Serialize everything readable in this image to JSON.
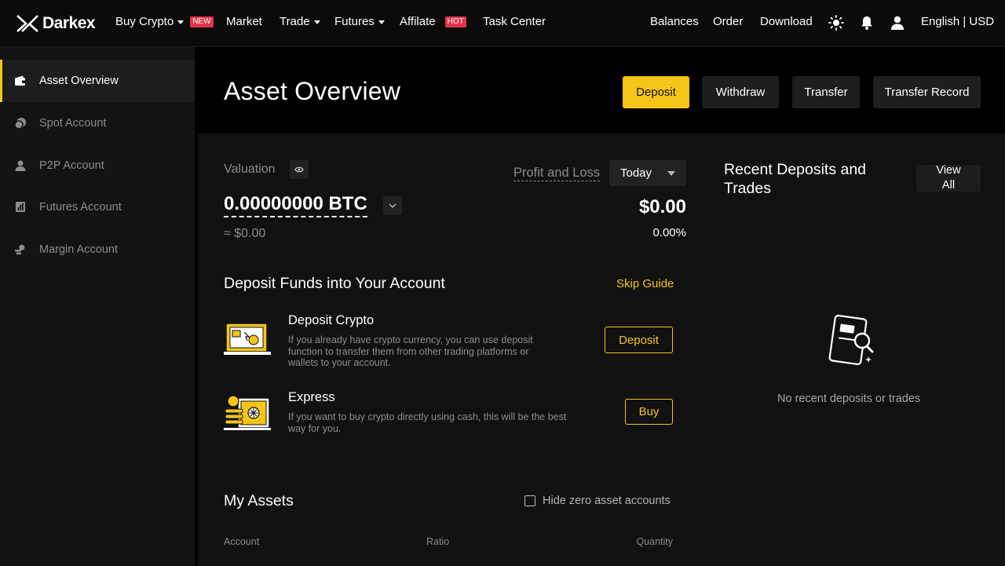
{
  "brand": {
    "name": "Darkex"
  },
  "topnav": {
    "items": [
      {
        "label": "Buy Crypto",
        "badge": "NEW",
        "has_caret": true
      },
      {
        "label": "Market"
      },
      {
        "label": "Trade",
        "has_caret": true
      },
      {
        "label": "Futures",
        "has_caret": true
      },
      {
        "label": "Affilate",
        "badge": "HOT"
      },
      {
        "label": "Task Center"
      }
    ],
    "right": {
      "balances": "Balances",
      "order": "Order",
      "download": "Download",
      "language": "English | USD",
      "icons": [
        "theme-sun-icon",
        "notification-bell-icon",
        "user-icon"
      ]
    }
  },
  "sidebar": {
    "items": [
      {
        "label": "Asset Overview",
        "icon": "wallet-icon",
        "active": true
      },
      {
        "label": "Spot Account",
        "icon": "coin-icon"
      },
      {
        "label": "P2P Account",
        "icon": "people-icon"
      },
      {
        "label": "Futures Account",
        "icon": "chart-icon"
      },
      {
        "label": "Margin Account",
        "icon": "margin-icon"
      }
    ]
  },
  "header": {
    "title": "Asset Overview",
    "buttons": {
      "deposit": "Deposit",
      "withdraw": "Withdraw",
      "transfer": "Transfer",
      "transfer_record": "Transfer Record"
    }
  },
  "valuation": {
    "label": "Valuation",
    "btc_value": "0.00000000 BTC",
    "fiat_value": "≈ $0.00",
    "pnl_label": "Profit and Loss",
    "period": "Today",
    "pnl_value": "$0.00",
    "pnl_percent": "0.00%"
  },
  "guide": {
    "title": "Deposit Funds into Your Account",
    "skip": "Skip Guide",
    "options": [
      {
        "title": "Deposit Crypto",
        "desc_lines": [
          "If you already have crypto currency, you can use deposit",
          "function to transfer them from other trading platforms or",
          "wallets to your account."
        ],
        "button": "Deposit"
      },
      {
        "title": "Express",
        "desc_lines": [
          "If you want to buy crypto directly using cash, this will be the best",
          "way for you."
        ],
        "button": "Buy"
      }
    ]
  },
  "recent": {
    "title_lines": [
      "Recent Deposits and",
      "Trades"
    ],
    "view_all_lines": [
      "View",
      "All"
    ],
    "empty_text": "No recent deposits or trades"
  },
  "assets": {
    "title": "My Assets",
    "hide_zero_label": "Hide zero asset accounts",
    "hide_zero_checked": false,
    "columns": [
      "Account",
      "Ratio",
      "Quantity"
    ]
  },
  "colors": {
    "accent": "#f5c518",
    "badge": "#e5344a",
    "panel": "#111111",
    "sidebar": "#131313"
  }
}
